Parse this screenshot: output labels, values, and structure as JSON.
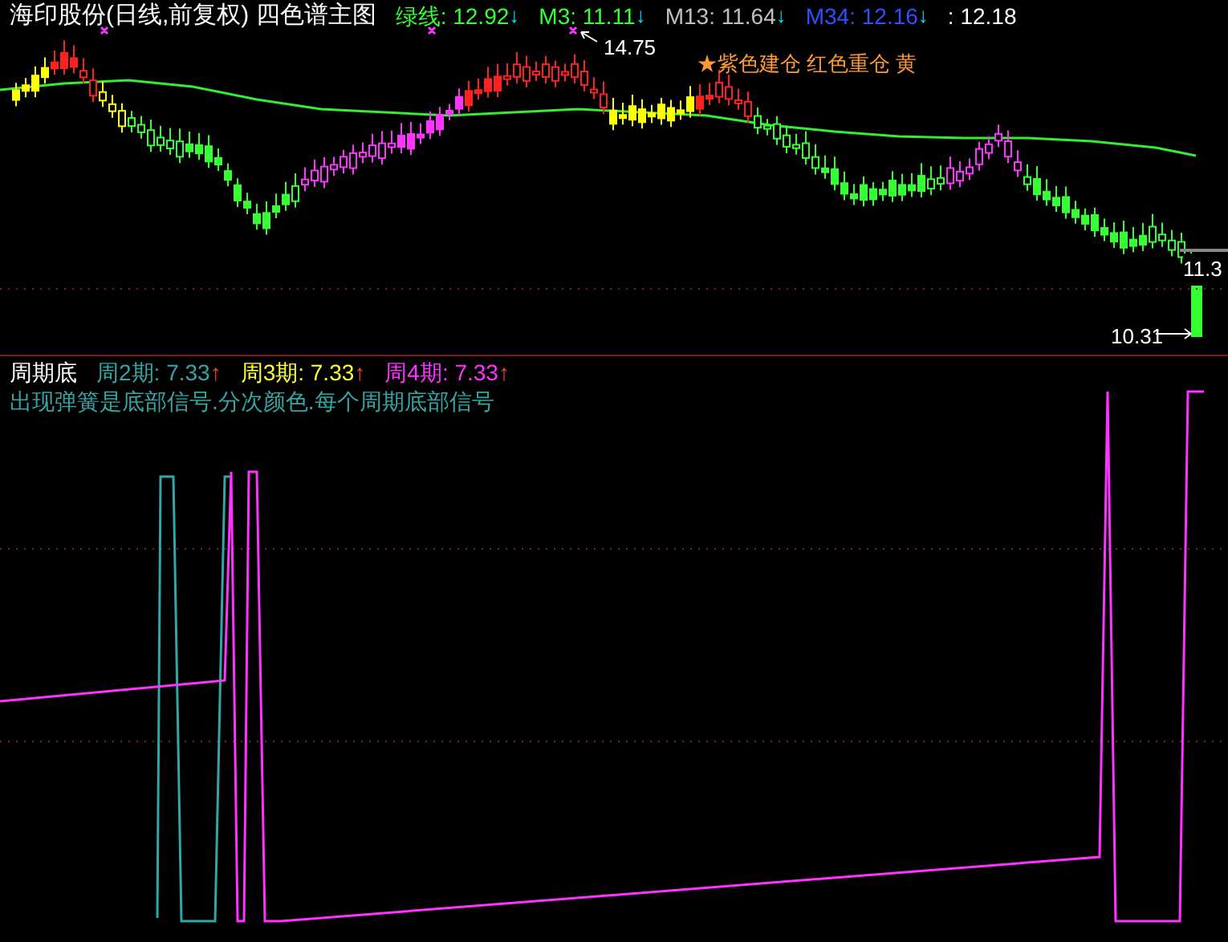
{
  "main_panel": {
    "title": "海印股份(日线,前复权) 四色谱主图",
    "indicators": [
      {
        "label": "绿线: 12.92",
        "arrow": "↓",
        "color": "#33ff33"
      },
      {
        "label": "M3: 11.11",
        "arrow": "↓",
        "color": "#33ff33"
      },
      {
        "label": "M13: 11.64",
        "arrow": "↓",
        "color": "#c0c0c0"
      },
      {
        "label": "M34: 12.16",
        "arrow": "↓",
        "color": "#3050ff"
      },
      {
        "label": ": 12.18",
        "color": "#ffffff"
      }
    ],
    "legend": "★紫色建仓  红色重仓  黄",
    "price_labels": {
      "high": "14.75",
      "last": "11.3",
      "low": "10.31"
    }
  },
  "sub_panel": {
    "title": "周期底",
    "series": [
      {
        "label": "周2期: 7.33",
        "arrow": "↑",
        "color": "#33a6a6"
      },
      {
        "label": "周3期: 7.33",
        "arrow": "↑",
        "color": "#ffff33"
      },
      {
        "label": "周4期: 7.33",
        "arrow": "↑",
        "color": "#ff33ff"
      }
    ],
    "note": "出现弹簧是底部信号.分次颜色.每个周期底部信号"
  }
}
